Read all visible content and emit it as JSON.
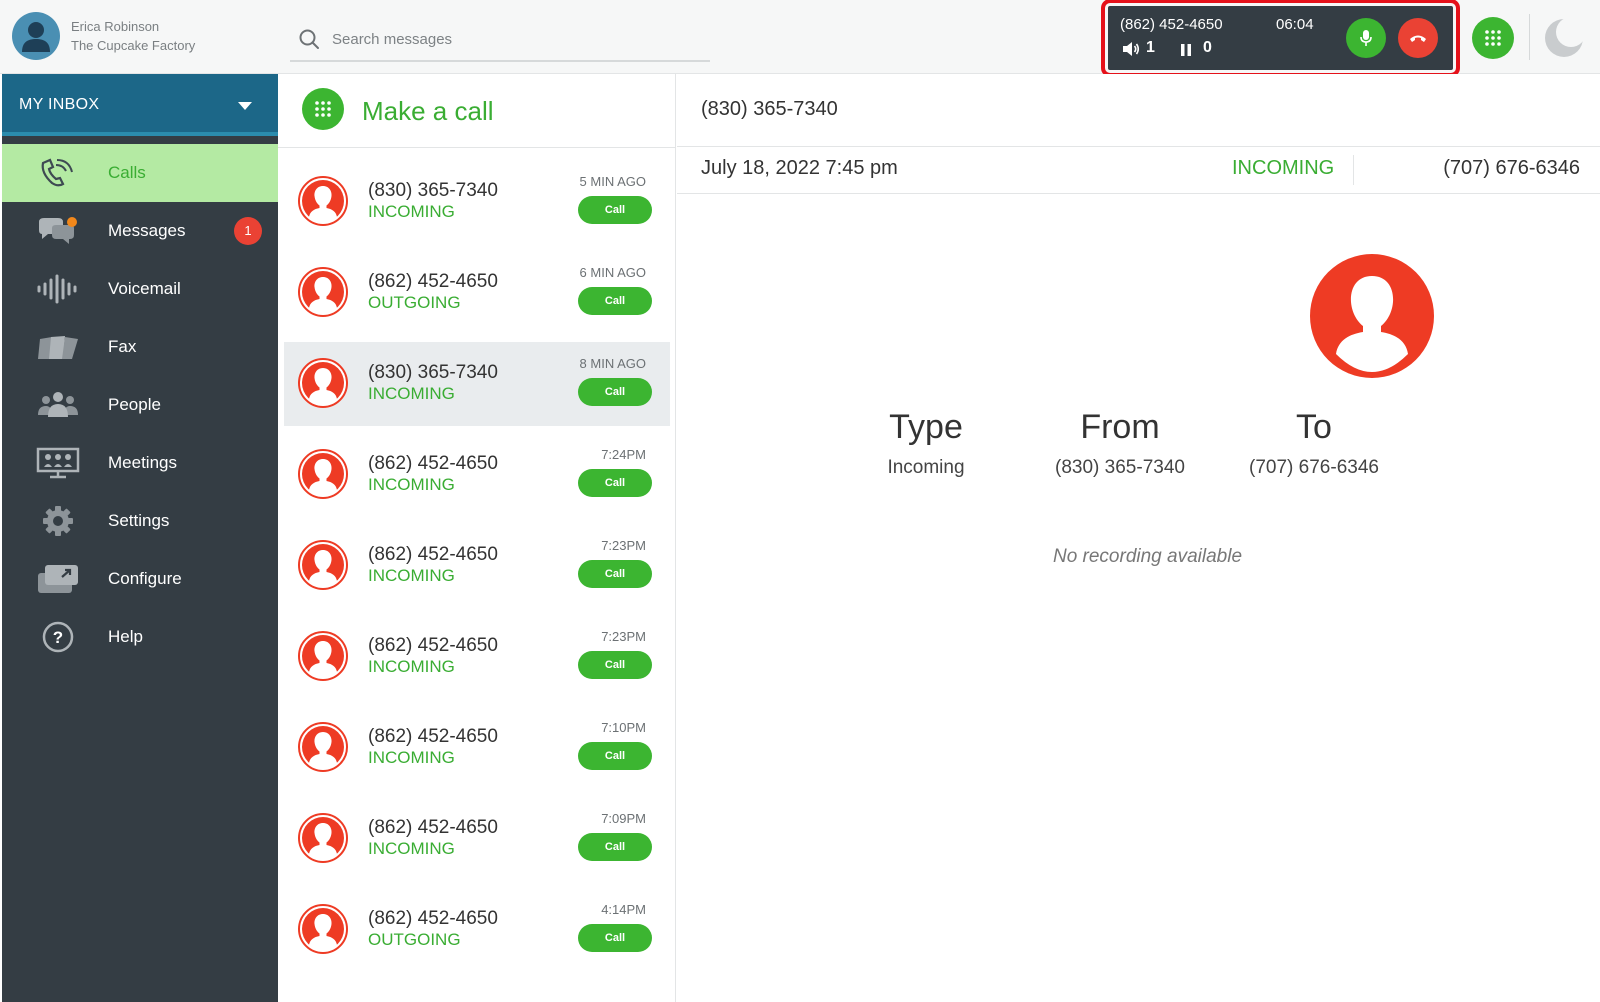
{
  "user": {
    "name": "Erica Robinson",
    "company": "The Cupcake Factory"
  },
  "search": {
    "placeholder": "Search messages"
  },
  "active_call": {
    "number": "(862) 452-4650",
    "timer": "06:04",
    "volume_count": "1",
    "hold_count": "0"
  },
  "sidebar": {
    "inbox_label": "MY INBOX",
    "items": [
      {
        "label": "Calls",
        "icon": "calls-icon",
        "active": true
      },
      {
        "label": "Messages",
        "icon": "messages-icon",
        "badge": "1"
      },
      {
        "label": "Voicemail",
        "icon": "voicemail-icon"
      },
      {
        "label": "Fax",
        "icon": "fax-icon"
      },
      {
        "label": "People",
        "icon": "people-icon"
      },
      {
        "label": "Meetings",
        "icon": "meetings-icon"
      },
      {
        "label": "Settings",
        "icon": "gear-icon"
      },
      {
        "label": "Configure",
        "icon": "configure-icon"
      },
      {
        "label": "Help",
        "icon": "help-icon"
      }
    ]
  },
  "call_list": {
    "make_call_label": "Make a call",
    "call_button_label": "Call",
    "rows": [
      {
        "number": "(830) 365-7340",
        "direction": "INCOMING",
        "time": "5 MIN AGO"
      },
      {
        "number": "(862) 452-4650",
        "direction": "OUTGOING",
        "time": "6 MIN AGO"
      },
      {
        "number": "(830) 365-7340",
        "direction": "INCOMING",
        "time": "8 MIN AGO",
        "selected": true
      },
      {
        "number": "(862) 452-4650",
        "direction": "INCOMING",
        "time": "7:24PM"
      },
      {
        "number": "(862) 452-4650",
        "direction": "INCOMING",
        "time": "7:23PM"
      },
      {
        "number": "(862) 452-4650",
        "direction": "INCOMING",
        "time": "7:23PM"
      },
      {
        "number": "(862) 452-4650",
        "direction": "INCOMING",
        "time": "7:10PM"
      },
      {
        "number": "(862) 452-4650",
        "direction": "INCOMING",
        "time": "7:09PM"
      },
      {
        "number": "(862) 452-4650",
        "direction": "OUTGOING",
        "time": "4:14PM"
      }
    ]
  },
  "detail": {
    "title": "(830) 365-7340",
    "date": "July 18, 2022 7:45 pm",
    "direction": "INCOMING",
    "to_number": "(707) 676-6346",
    "type_label": "Type",
    "type_value": "Incoming",
    "from_label": "From",
    "from_value": "(830) 365-7340",
    "to_label": "To",
    "to_value": "(707) 676-6346",
    "no_recording": "No recording available"
  },
  "colors": {
    "brand_green": "#3cb531",
    "danger_red": "#ea4234",
    "sidebar_bg": "#343d44",
    "inbox_blue": "#1c6788",
    "active_bg": "#b4eaa3"
  }
}
